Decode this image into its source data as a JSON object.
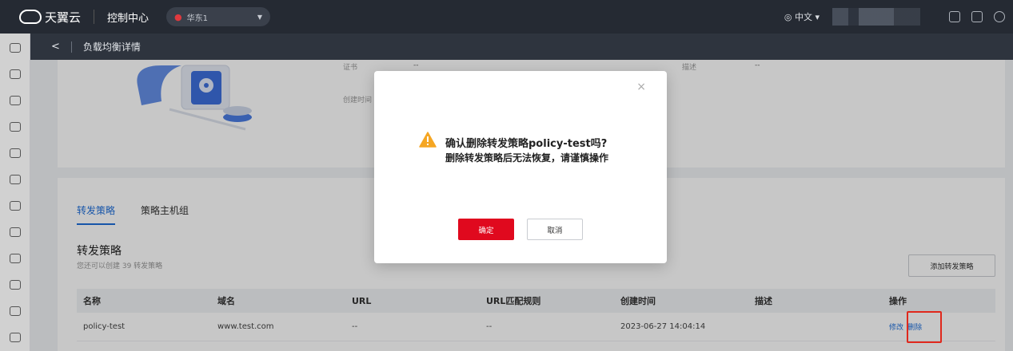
{
  "topbar": {
    "brand": "天翼云",
    "console": "控制中心",
    "region": "华东1",
    "language": "中文"
  },
  "subheader": {
    "back": "<",
    "title": "负载均衡详情"
  },
  "info": {
    "cert_label": "证书",
    "cert_value": "--",
    "desc_label": "描述",
    "desc_value": "--",
    "created_label": "创建时间"
  },
  "tabs": [
    "转发策略",
    "策略主机组"
  ],
  "section": {
    "title": "转发策略",
    "subtitle": "您还可以创建 39 转发策略",
    "add_button": "添加转发策略"
  },
  "table": {
    "headers": [
      "名称",
      "域名",
      "URL",
      "URL匹配规则",
      "创建时间",
      "描述",
      "操作"
    ],
    "rows": [
      {
        "name": "policy-test",
        "domain": "www.test.com",
        "url": "--",
        "rule": "--",
        "created": "2023-06-27 14:04:14",
        "desc": "",
        "edit": "修改",
        "delete": "删除"
      }
    ]
  },
  "modal": {
    "close": "×",
    "title": "确认删除转发策略policy-test吗?",
    "message": "删除转发策略后无法恢复，请谨慎操作",
    "ok": "确定",
    "cancel": "取消"
  },
  "colors": {
    "accent": "#1e6ed9",
    "danger": "#e0091e",
    "warning": "#f5a623",
    "topbar": "#252a33"
  }
}
